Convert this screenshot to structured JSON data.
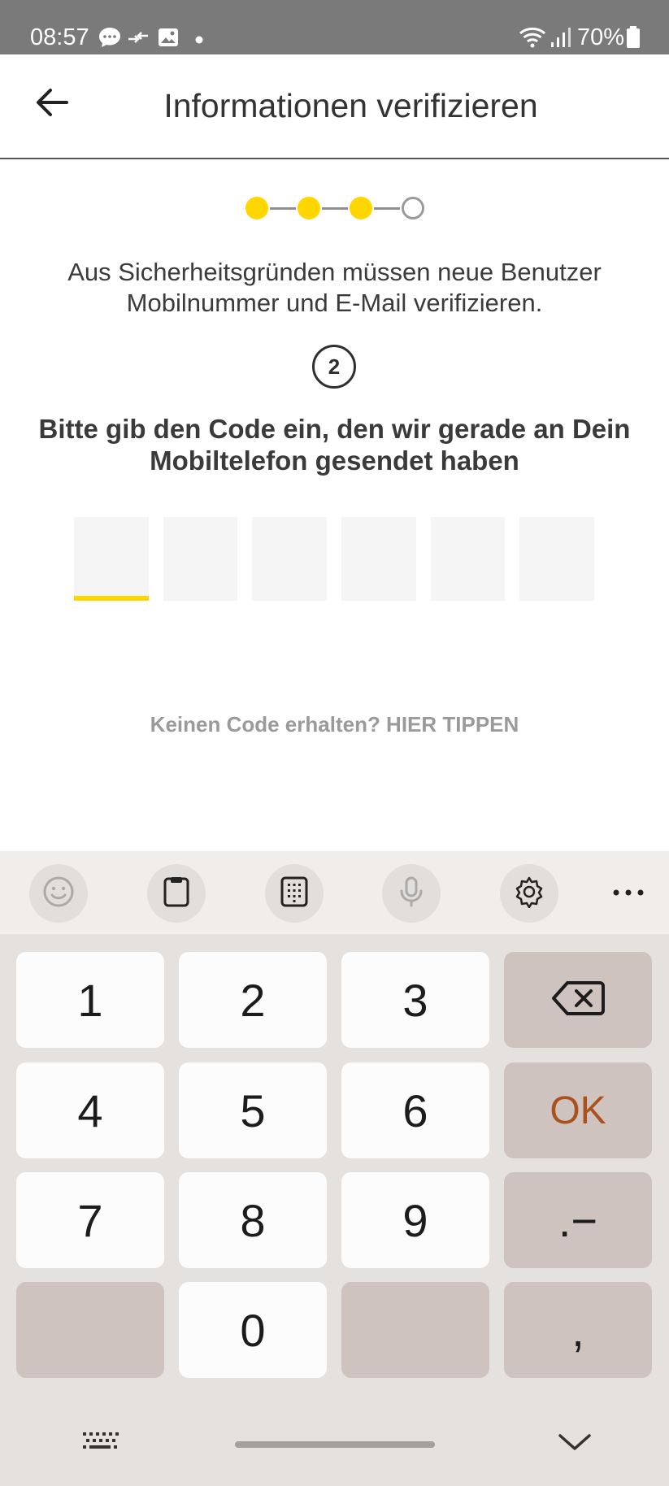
{
  "status_bar": {
    "time": "08:57",
    "battery_percent": "70%",
    "icons": [
      "chat-bubble-icon",
      "transfer-icon",
      "gallery-icon",
      "dot-icon",
      "wifi-icon",
      "signal-icon",
      "battery-icon"
    ]
  },
  "header": {
    "title": "Informationen verifizieren",
    "back_icon": "arrow-left-icon"
  },
  "stepper": {
    "total_steps": 4,
    "completed_steps": 3,
    "accent_color": "#ffd600"
  },
  "content": {
    "info_text": "Aus Sicherheitsgründen müssen neue Benutzer Mobilnummer und E-Mail verifizieren.",
    "step_number": "2",
    "instruction": "Bitte gib den Code ein, den wir gerade an Dein Mobiltelefon gesendet haben",
    "code_length": 6,
    "code_values": [
      "",
      "",
      "",
      "",
      "",
      ""
    ],
    "active_code_index": 0,
    "resend_text": "Keinen Code erhalten? HIER TIPPEN"
  },
  "keyboard": {
    "toolbar": [
      "emoji-icon",
      "clipboard-icon",
      "keypad-icon",
      "microphone-icon",
      "settings-icon",
      "more-icon"
    ],
    "rows": [
      [
        "1",
        "2",
        "3",
        "⌫"
      ],
      [
        "4",
        "5",
        "6",
        "OK"
      ],
      [
        "7",
        "8",
        "9",
        ".−"
      ],
      [
        "",
        "0",
        "",
        ","
      ]
    ],
    "ok_color": "#a9521e"
  }
}
